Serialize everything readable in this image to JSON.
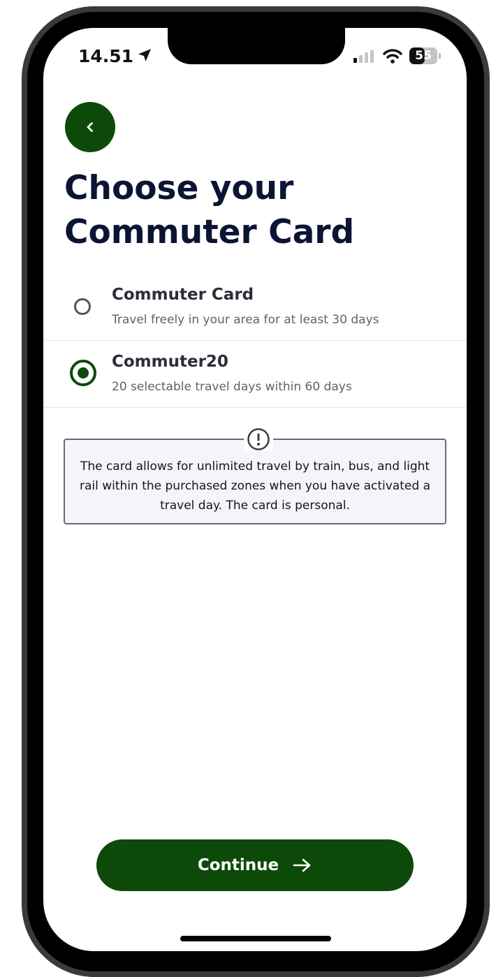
{
  "status_bar": {
    "time": "14.51",
    "battery": "55",
    "battery_level": 0.55,
    "location_icon": "location-arrow-icon",
    "signal_icon": "cellular-signal-icon",
    "wifi_icon": "wifi-icon"
  },
  "header": {
    "back_icon": "chevron-left-icon",
    "title": "Choose your Commuter Card"
  },
  "options": [
    {
      "title": "Commuter Card",
      "subtitle": "Travel freely in your area for at least 30 days",
      "selected": false
    },
    {
      "title": "Commuter20",
      "subtitle": "20 selectable travel days within 60 days",
      "selected": true
    }
  ],
  "info": {
    "icon": "exclamation-circle-icon",
    "text": "The card allows for unlimited travel by train, bus, and light rail within the purchased zones when you have activated a travel day. The card is personal."
  },
  "footer": {
    "continue_label": "Continue",
    "continue_icon": "arrow-right-icon"
  },
  "colors": {
    "accent": "#0d4a0a",
    "title_text": "#0b1533",
    "info_background": "#f4f4f9"
  }
}
